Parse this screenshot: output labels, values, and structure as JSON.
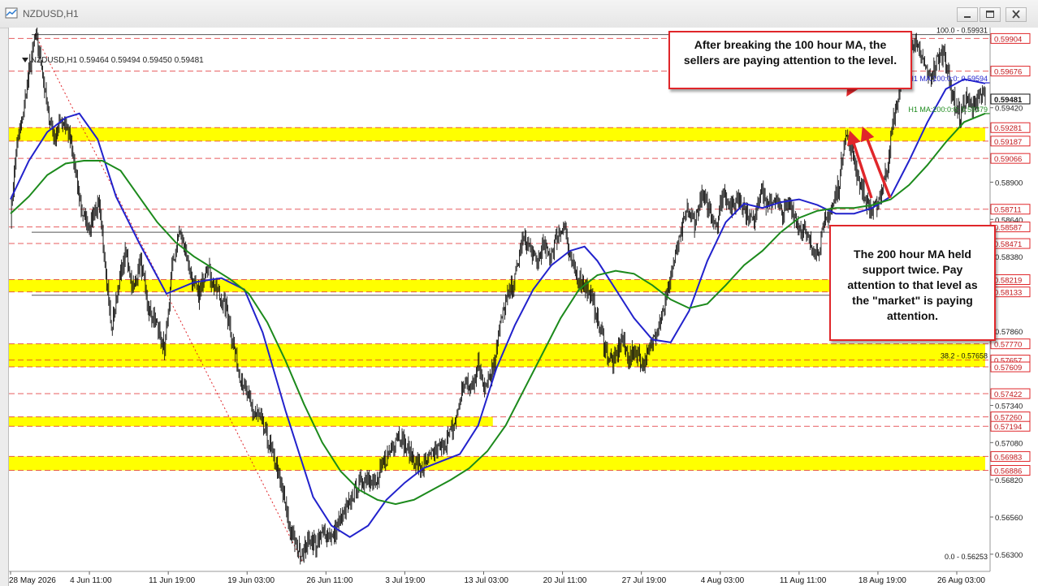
{
  "window": {
    "title": "NZDUSD,H1",
    "icons": [
      "chart-window-icon",
      "minimize-icon",
      "maximize-icon",
      "close-icon"
    ]
  },
  "header": {
    "symbol": "NZDUSD,H1",
    "ohlc": "0.59464 0.59494 0.59450 0.59481"
  },
  "colors": {
    "ma100": "#2222cc",
    "ma200": "#1c8a1c",
    "zone": "#ffff00",
    "candle": "#111111",
    "level_line": "#e0262a",
    "callout_border": "#e0262a",
    "arrow": "#e0262a"
  },
  "annotations": {
    "callout_top": "After breaking the 100 hour MA, the sellers are paying attention to the level.",
    "callout_right": "The 200 hour MA held support twice.  Pay attention to that level as the \"market\" is paying attention."
  },
  "chart_data": {
    "type": "candlestick",
    "title": "",
    "ylim": [
      0.5618,
      0.5998
    ],
    "grid": false,
    "x_ticks": [
      "28 May 2026",
      "4 Jun 11:00",
      "11 Jun 19:00",
      "19 Jun 03:00",
      "26 Jun 11:00",
      "3 Jul 19:00",
      "13 Jul 03:00",
      "20 Jul 11:00",
      "27 Jul 19:00",
      "4 Aug 03:00",
      "11 Aug 11:00",
      "18 Aug 19:00",
      "26 Aug 03:00"
    ],
    "x_tick_index": [
      0,
      86,
      172,
      258,
      344,
      430,
      516,
      602,
      688,
      774,
      860,
      946,
      1032
    ],
    "y_ticks": [
      "0.59904",
      "0.59676",
      "0.59420",
      "0.59281",
      "0.59187",
      "0.59066",
      "0.58900",
      "0.58711",
      "0.58640",
      "0.58587",
      "0.58471",
      "0.58380",
      "0.58219",
      "0.58133",
      "0.57860",
      "0.57770",
      "0.57657",
      "0.57609",
      "0.57422",
      "0.57340",
      "0.57260",
      "0.57194",
      "0.57080",
      "0.56983",
      "0.56886",
      "0.56820",
      "0.56560",
      "0.56300"
    ],
    "current_price": "0.59481",
    "fib_levels": [
      {
        "label": "100.0 - 0.59931",
        "value": 0.59931
      },
      {
        "label": "38.2 - 0.57658",
        "value": 0.57658
      },
      {
        "label": "0.0 - 0.56253",
        "value": 0.56253
      }
    ],
    "ma_labels": [
      {
        "label": "H1 MA:100:0:0: 0.59594",
        "value": 0.59594,
        "series": "ma100"
      },
      {
        "label": "H1 MA:200:0:0: 0.59379",
        "value": 0.59379,
        "series": "ma200"
      }
    ],
    "zones": [
      {
        "from": 0.59187,
        "to": 0.59281,
        "x_end": 1063
      },
      {
        "from": 0.58133,
        "to": 0.58219,
        "x_end": 1063
      },
      {
        "from": 0.57609,
        "to": 0.5777,
        "x_end": 1063
      },
      {
        "from": 0.57194,
        "to": 0.5726,
        "x_end": 526
      },
      {
        "from": 0.56886,
        "to": 0.56983,
        "x_end": 1063
      }
    ],
    "red_levels": [
      0.59904,
      0.59676,
      0.59281,
      0.59187,
      0.59066,
      0.58711,
      0.58587,
      0.58471,
      0.58219,
      0.58133,
      0.5777,
      0.57657,
      0.57609,
      0.57422,
      0.5726,
      0.57194,
      0.56983,
      0.56886
    ],
    "black_levels": [
      0.59931,
      0.5855,
      0.5811
    ],
    "bar_count": 1063,
    "price_path": [
      [
        0,
        0.5866
      ],
      [
        6,
        0.591
      ],
      [
        14,
        0.594
      ],
      [
        22,
        0.5975
      ],
      [
        27,
        0.5993
      ],
      [
        34,
        0.5972
      ],
      [
        40,
        0.594
      ],
      [
        48,
        0.592
      ],
      [
        55,
        0.5935
      ],
      [
        62,
        0.5928
      ],
      [
        70,
        0.59
      ],
      [
        78,
        0.5868
      ],
      [
        86,
        0.586
      ],
      [
        96,
        0.5875
      ],
      [
        104,
        0.583
      ],
      [
        110,
        0.5785
      ],
      [
        118,
        0.582
      ],
      [
        126,
        0.584
      ],
      [
        134,
        0.5815
      ],
      [
        142,
        0.5835
      ],
      [
        150,
        0.58
      ],
      [
        160,
        0.579
      ],
      [
        168,
        0.577
      ],
      [
        176,
        0.583
      ],
      [
        184,
        0.5855
      ],
      [
        190,
        0.5845
      ],
      [
        198,
        0.582
      ],
      [
        206,
        0.581
      ],
      [
        214,
        0.5835
      ],
      [
        220,
        0.582
      ],
      [
        228,
        0.581
      ],
      [
        236,
        0.58
      ],
      [
        242,
        0.578
      ],
      [
        248,
        0.576
      ],
      [
        256,
        0.5745
      ],
      [
        264,
        0.573
      ],
      [
        272,
        0.5725
      ],
      [
        280,
        0.571
      ],
      [
        288,
        0.5695
      ],
      [
        296,
        0.5675
      ],
      [
        304,
        0.565
      ],
      [
        312,
        0.5635
      ],
      [
        318,
        0.5632
      ],
      [
        326,
        0.564
      ],
      [
        334,
        0.5636
      ],
      [
        342,
        0.5646
      ],
      [
        352,
        0.5642
      ],
      [
        360,
        0.5655
      ],
      [
        368,
        0.5662
      ],
      [
        374,
        0.5672
      ],
      [
        382,
        0.568
      ],
      [
        390,
        0.5686
      ],
      [
        398,
        0.5678
      ],
      [
        406,
        0.5692
      ],
      [
        414,
        0.5702
      ],
      [
        422,
        0.5715
      ],
      [
        430,
        0.5706
      ],
      [
        438,
        0.5698
      ],
      [
        446,
        0.569
      ],
      [
        454,
        0.5694
      ],
      [
        462,
        0.5702
      ],
      [
        470,
        0.5705
      ],
      [
        478,
        0.5712
      ],
      [
        486,
        0.5725
      ],
      [
        494,
        0.575
      ],
      [
        502,
        0.5745
      ],
      [
        510,
        0.5762
      ],
      [
        518,
        0.5748
      ],
      [
        526,
        0.576
      ],
      [
        534,
        0.579
      ],
      [
        542,
        0.581
      ],
      [
        550,
        0.5822
      ],
      [
        558,
        0.585
      ],
      [
        566,
        0.5845
      ],
      [
        574,
        0.5832
      ],
      [
        580,
        0.5845
      ],
      [
        588,
        0.5838
      ],
      [
        596,
        0.5852
      ],
      [
        604,
        0.586
      ],
      [
        610,
        0.5835
      ],
      [
        618,
        0.5825
      ],
      [
        626,
        0.5818
      ],
      [
        634,
        0.5808
      ],
      [
        642,
        0.579
      ],
      [
        650,
        0.577
      ],
      [
        658,
        0.5764
      ],
      [
        666,
        0.578
      ],
      [
        674,
        0.5768
      ],
      [
        682,
        0.5772
      ],
      [
        690,
        0.5762
      ],
      [
        698,
        0.5775
      ],
      [
        706,
        0.579
      ],
      [
        714,
        0.5806
      ],
      [
        722,
        0.583
      ],
      [
        730,
        0.585
      ],
      [
        738,
        0.587
      ],
      [
        746,
        0.5862
      ],
      [
        754,
        0.588
      ],
      [
        762,
        0.5872
      ],
      [
        770,
        0.586
      ],
      [
        778,
        0.5885
      ],
      [
        786,
        0.5872
      ],
      [
        794,
        0.588
      ],
      [
        802,
        0.587
      ],
      [
        810,
        0.5862
      ],
      [
        818,
        0.5888
      ],
      [
        826,
        0.5872
      ],
      [
        834,
        0.588
      ],
      [
        842,
        0.5868
      ],
      [
        850,
        0.5875
      ],
      [
        858,
        0.5862
      ],
      [
        866,
        0.5855
      ],
      [
        874,
        0.5845
      ],
      [
        880,
        0.584
      ],
      [
        888,
        0.586
      ],
      [
        896,
        0.5872
      ],
      [
        904,
        0.589
      ],
      [
        910,
        0.5925
      ],
      [
        918,
        0.591
      ],
      [
        926,
        0.589
      ],
      [
        934,
        0.5875
      ],
      [
        940,
        0.5868
      ],
      [
        948,
        0.588
      ],
      [
        956,
        0.59
      ],
      [
        962,
        0.593
      ],
      [
        970,
        0.5955
      ],
      [
        976,
        0.5975
      ],
      [
        984,
        0.5988
      ],
      [
        990,
        0.5982
      ],
      [
        998,
        0.597
      ],
      [
        1004,
        0.5962
      ],
      [
        1010,
        0.5975
      ],
      [
        1018,
        0.5982
      ],
      [
        1024,
        0.596
      ],
      [
        1030,
        0.5945
      ],
      [
        1036,
        0.5936
      ],
      [
        1042,
        0.595
      ],
      [
        1048,
        0.594
      ],
      [
        1056,
        0.5952
      ],
      [
        1063,
        0.5948
      ]
    ],
    "series": [
      {
        "key": "ma100",
        "values": [
          [
            0,
            0.5878
          ],
          [
            20,
            0.5905
          ],
          [
            40,
            0.5925
          ],
          [
            60,
            0.5935
          ],
          [
            75,
            0.5938
          ],
          [
            95,
            0.592
          ],
          [
            115,
            0.588
          ],
          [
            140,
            0.5848
          ],
          [
            170,
            0.5812
          ],
          [
            200,
            0.582
          ],
          [
            230,
            0.5823
          ],
          [
            255,
            0.5815
          ],
          [
            275,
            0.5785
          ],
          [
            300,
            0.573
          ],
          [
            330,
            0.567
          ],
          [
            350,
            0.565
          ],
          [
            370,
            0.5642
          ],
          [
            390,
            0.565
          ],
          [
            410,
            0.5668
          ],
          [
            430,
            0.568
          ],
          [
            450,
            0.569
          ],
          [
            470,
            0.5695
          ],
          [
            490,
            0.57
          ],
          [
            510,
            0.572
          ],
          [
            530,
            0.576
          ],
          [
            550,
            0.579
          ],
          [
            570,
            0.5815
          ],
          [
            590,
            0.5832
          ],
          [
            610,
            0.5842
          ],
          [
            626,
            0.5845
          ],
          [
            640,
            0.5835
          ],
          [
            660,
            0.5815
          ],
          [
            680,
            0.5795
          ],
          [
            700,
            0.578
          ],
          [
            720,
            0.5778
          ],
          [
            740,
            0.58
          ],
          [
            760,
            0.5835
          ],
          [
            780,
            0.5862
          ],
          [
            800,
            0.5875
          ],
          [
            820,
            0.5872
          ],
          [
            840,
            0.5876
          ],
          [
            860,
            0.5878
          ],
          [
            880,
            0.5874
          ],
          [
            900,
            0.5868
          ],
          [
            920,
            0.5868
          ],
          [
            940,
            0.5872
          ],
          [
            960,
            0.588
          ],
          [
            980,
            0.5905
          ],
          [
            1000,
            0.5932
          ],
          [
            1020,
            0.5955
          ],
          [
            1040,
            0.5962
          ],
          [
            1063,
            0.5959
          ]
        ]
      },
      {
        "key": "ma200",
        "values": [
          [
            0,
            0.5868
          ],
          [
            20,
            0.588
          ],
          [
            40,
            0.5895
          ],
          [
            60,
            0.5903
          ],
          [
            80,
            0.5905
          ],
          [
            100,
            0.5905
          ],
          [
            120,
            0.5898
          ],
          [
            140,
            0.588
          ],
          [
            160,
            0.5862
          ],
          [
            180,
            0.5848
          ],
          [
            200,
            0.5838
          ],
          [
            220,
            0.583
          ],
          [
            240,
            0.5822
          ],
          [
            260,
            0.5812
          ],
          [
            280,
            0.5792
          ],
          [
            300,
            0.5765
          ],
          [
            320,
            0.5735
          ],
          [
            340,
            0.5708
          ],
          [
            360,
            0.5688
          ],
          [
            380,
            0.5675
          ],
          [
            400,
            0.5668
          ],
          [
            420,
            0.5665
          ],
          [
            440,
            0.5668
          ],
          [
            460,
            0.5675
          ],
          [
            480,
            0.5682
          ],
          [
            500,
            0.569
          ],
          [
            520,
            0.5702
          ],
          [
            540,
            0.572
          ],
          [
            560,
            0.5745
          ],
          [
            580,
            0.577
          ],
          [
            600,
            0.5795
          ],
          [
            620,
            0.5815
          ],
          [
            640,
            0.5825
          ],
          [
            660,
            0.5828
          ],
          [
            680,
            0.5826
          ],
          [
            700,
            0.5818
          ],
          [
            720,
            0.5808
          ],
          [
            740,
            0.5802
          ],
          [
            760,
            0.5805
          ],
          [
            780,
            0.5818
          ],
          [
            800,
            0.5832
          ],
          [
            820,
            0.5842
          ],
          [
            840,
            0.5855
          ],
          [
            860,
            0.5865
          ],
          [
            880,
            0.587
          ],
          [
            900,
            0.5872
          ],
          [
            920,
            0.5872
          ],
          [
            940,
            0.5874
          ],
          [
            960,
            0.5878
          ],
          [
            980,
            0.5888
          ],
          [
            1000,
            0.5902
          ],
          [
            1020,
            0.5918
          ],
          [
            1040,
            0.5932
          ],
          [
            1063,
            0.5938
          ]
        ]
      }
    ]
  }
}
